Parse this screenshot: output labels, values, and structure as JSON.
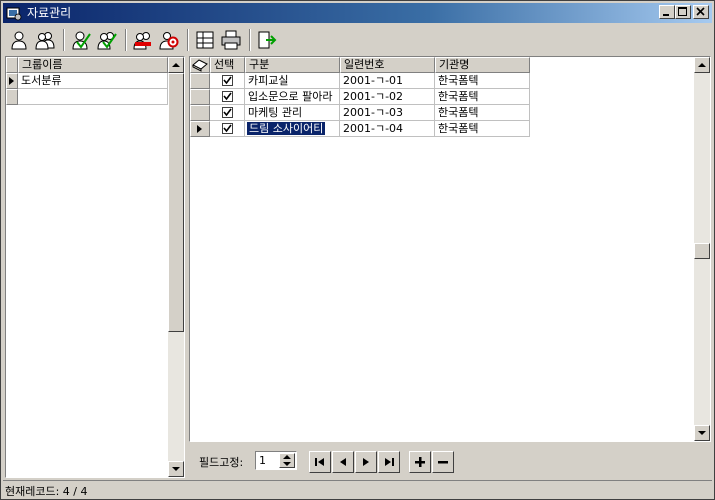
{
  "window": {
    "title": "자료관리"
  },
  "toolbar": {
    "icons": [
      "user-icon",
      "users-icon",
      "user-edit-icon",
      "users-edit-icon",
      "users-delete-icon",
      "user-search-icon",
      "layout-icon",
      "print-icon",
      "exit-icon"
    ]
  },
  "groups": {
    "header": "그룹이름",
    "items": [
      "도서분류"
    ]
  },
  "records": {
    "headers": {
      "select": "선택",
      "category": "구분",
      "serial": "일련번호",
      "org": "기관명"
    },
    "rows": [
      {
        "checked": true,
        "category": "카피교실",
        "serial": "2001-ㄱ-01",
        "org": "한국폼텍"
      },
      {
        "checked": true,
        "category": "입소문으로 팔아라",
        "serial": "2001-ㄱ-02",
        "org": "한국폼텍"
      },
      {
        "checked": true,
        "category": "마케팅 관리",
        "serial": "2001-ㄱ-03",
        "org": "한국폼텍"
      },
      {
        "checked": true,
        "category": "드림 소사이어티",
        "serial": "2001-ㄱ-04",
        "org": "한국폼텍"
      }
    ]
  },
  "navbar": {
    "freeze_label": "필드고정:",
    "freeze_value": "1"
  },
  "status": {
    "text": "현재레코드: 4 / 4"
  }
}
